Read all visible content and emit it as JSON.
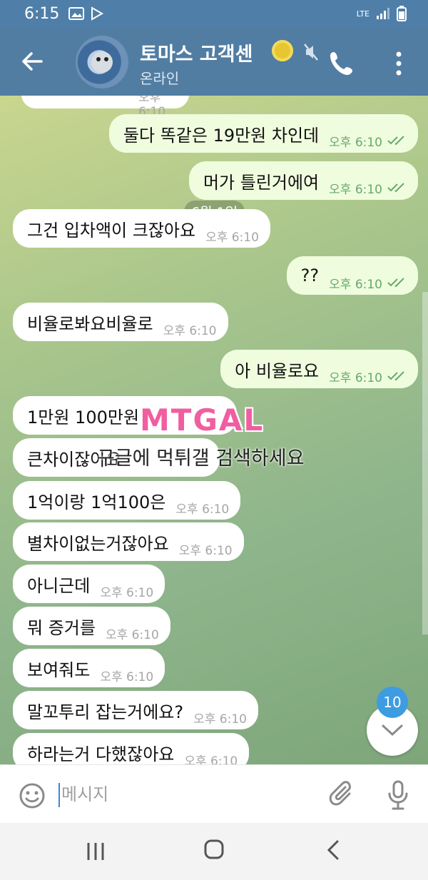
{
  "status_bar": {
    "time": "6:15",
    "network": "LTE"
  },
  "header": {
    "title": "토마스 고객센",
    "status": "온라인"
  },
  "chat": {
    "date": "6월 1일",
    "partial_meta": "오후 6:10",
    "messages": [
      {
        "side": "out",
        "text": "둘다 똑같은 19만원 차인데",
        "time": "오후 6:10",
        "read": true
      },
      {
        "side": "out",
        "text": "머가 틀린거에여",
        "time": "오후 6:10",
        "read": true
      },
      {
        "side": "in",
        "text": "그건 입차액이 크잖아요",
        "time": "오후 6:10"
      },
      {
        "side": "out",
        "text": "??",
        "time": "오후 6:10",
        "read": true
      },
      {
        "side": "in",
        "text": "비율로봐요비율로",
        "time": "오후 6:10"
      },
      {
        "side": "out",
        "text": "아 비율로요",
        "time": "오후 6:10",
        "read": true
      },
      {
        "side": "in",
        "text": "1만원 100만원",
        "time": ""
      },
      {
        "side": "in",
        "text": "큰차이잖아요",
        "time": ""
      },
      {
        "side": "in",
        "text": "1억이랑 1억100은",
        "time": "오후 6:10"
      },
      {
        "side": "in",
        "text": "별차이없는거잖아요",
        "time": "오후 6:10"
      },
      {
        "side": "in",
        "text": "아니근데",
        "time": "오후 6:10"
      },
      {
        "side": "in",
        "text": "뭐 증거를",
        "time": "오후 6:10"
      },
      {
        "side": "in",
        "text": "보여줘도",
        "time": "오후 6:10"
      },
      {
        "side": "in",
        "text": "말꼬투리 잡는거에요?",
        "time": "오후 6:10"
      },
      {
        "side": "in",
        "text": "하라는거 다했잖아요",
        "time": "오후 6:10"
      }
    ],
    "watermark": {
      "logo": "MTGAL",
      "text": "구글에 먹튀갤 검색하세요"
    },
    "unread_count": "10"
  },
  "composer": {
    "placeholder": "메시지"
  },
  "colors": {
    "header": "#517da2",
    "incoming": "#ffffff",
    "outgoing": "#effdde",
    "unread": "#3d9ce2"
  },
  "icons": [
    "back-arrow-icon",
    "muted-icon",
    "phone-icon",
    "more-vert-icon",
    "emoji-icon",
    "attach-icon",
    "mic-icon",
    "chevron-down-icon",
    "read-check-icon"
  ]
}
